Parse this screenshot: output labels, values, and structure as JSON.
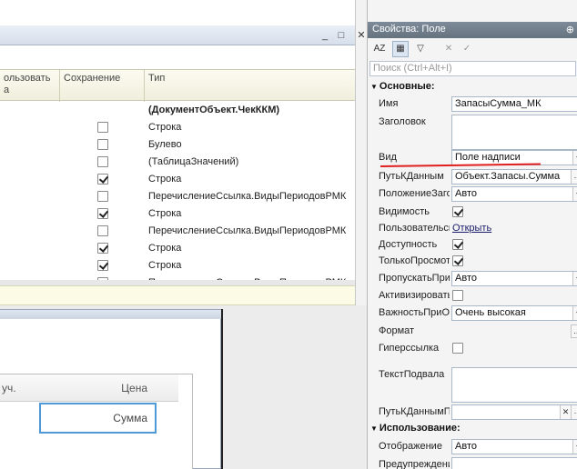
{
  "left_window": {
    "columns": [
      {
        "label": "ользовать\nа"
      },
      {
        "label": "Сохранение"
      },
      {
        "label": "Тип"
      }
    ],
    "rows": [
      {
        "checked": null,
        "type": "(ДокументОбъект.ЧекККМ)",
        "bold": true
      },
      {
        "checked": false,
        "type": "Строка"
      },
      {
        "checked": false,
        "type": "Булево"
      },
      {
        "checked": false,
        "type": "(ТаблицаЗначений)"
      },
      {
        "checked": true,
        "type": "Строка"
      },
      {
        "checked": false,
        "type": "ПеречислениеСсылка.ВидыПериодовРМК"
      },
      {
        "checked": true,
        "type": "Строка"
      },
      {
        "checked": false,
        "type": "ПеречислениеСсылка.ВидыПериодовРМК"
      },
      {
        "checked": true,
        "type": "Строка"
      },
      {
        "checked": true,
        "type": "Строка"
      },
      {
        "checked": false,
        "type": "ПеречислениеСсылка.ВидыПериодовРМК"
      }
    ],
    "buttons": {
      "minimize": "_",
      "maximize": "□",
      "close": "✕"
    }
  },
  "form_preview": {
    "header_left": "уч.",
    "header_price": "Цена",
    "cell_value": "Сумма"
  },
  "properties": {
    "title": "Свойства: Поле",
    "search_placeholder": "Поиск (Ctrl+Alt+I)",
    "toolbar": {
      "sort": "AZ",
      "x": "✕",
      "ok": "✓"
    },
    "sections": {
      "main": "Основные:",
      "usage": "Использование:"
    },
    "rows": {
      "name": {
        "label": "Имя",
        "value": "ЗапасыСумма_МК"
      },
      "header": {
        "label": "Заголовок"
      },
      "kind": {
        "label": "Вид",
        "value": "Поле надписи"
      },
      "data_path": {
        "label": "ПутьКДанным",
        "value": "Объект.Запасы.Сумма"
      },
      "position": {
        "label": "ПоложениеЗаголовка",
        "value": "Авто"
      },
      "visibility": {
        "label": "Видимость",
        "checked": true
      },
      "user": {
        "label": "Пользовательская видимость",
        "link": "Открыть"
      },
      "access": {
        "label": "Доступность",
        "checked": true
      },
      "readonly": {
        "label": "ТолькоПросмотр",
        "checked": true
      },
      "skip": {
        "label": "ПропускатьПриВводе",
        "value": "Авто"
      },
      "activate": {
        "label": "АктивизироватьПоУмолчанию",
        "checked": false
      },
      "importance": {
        "label": "ВажностьПриОтображении",
        "value": "Очень высокая"
      },
      "format": {
        "label": "Формат"
      },
      "hyperlink": {
        "label": "Гиперссылка",
        "checked": false
      },
      "footer": {
        "label": "ТекстПодвала"
      },
      "footer_path": {
        "label": "ПутьКДаннымПодвала"
      },
      "display": {
        "label": "Отображение",
        "value": "Авто"
      },
      "warning": {
        "label": "Предупреждение"
      }
    }
  },
  "colors": {
    "accent": "#4e9ad8",
    "title_bar": "#6f7c8a",
    "highlight": "#e02020"
  }
}
